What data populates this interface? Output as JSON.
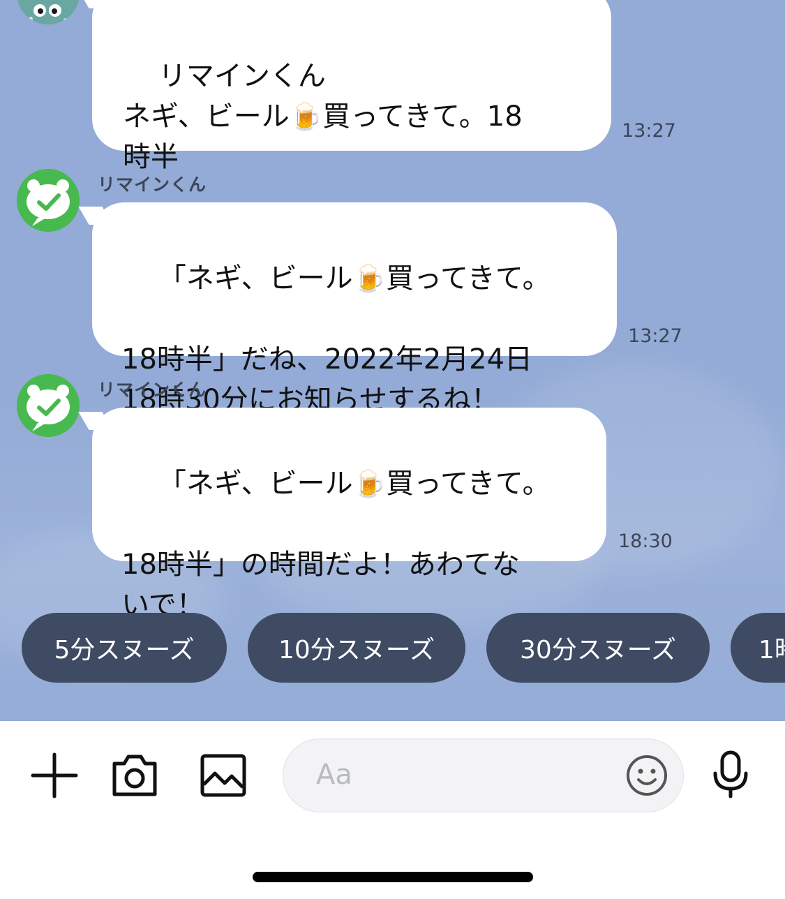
{
  "bot_name": "リマインくん",
  "messages": [
    {
      "sender": "user",
      "text": "リマインくん\nネギ、ビール",
      "after_emoji": "買ってきて。18\n時半",
      "time": "13:27"
    },
    {
      "sender": "bot",
      "name": "リマインくん",
      "line1a": "「ネギ、ビール",
      "line1b": "買ってきて。",
      "rest": "18時半」だね、2022年2月24日\n18時30分にお知らせするね！",
      "time": "13:27"
    },
    {
      "sender": "bot",
      "name": "リマインくん",
      "line1a": "「ネギ、ビール",
      "line1b": "買ってきて。",
      "rest": "18時半」の時間だよ！あわてな\nいで！",
      "time": "18:30"
    }
  ],
  "emoji": "🍺",
  "quick_replies": [
    "5分スヌーズ",
    "10分スヌーズ",
    "30分スヌーズ",
    "1時"
  ],
  "input": {
    "placeholder": "Aa"
  },
  "icons": {
    "plus": "plus-icon",
    "camera": "camera-icon",
    "image": "image-icon",
    "emoji": "smiley-icon",
    "mic": "microphone-icon",
    "bot_avatar": "checkmark-chat-avatar"
  },
  "colors": {
    "chat_background": "#93abd6",
    "bubble": "#ffffff",
    "quick_reply": "#3f4a63",
    "bot_avatar": "#47b94f"
  }
}
